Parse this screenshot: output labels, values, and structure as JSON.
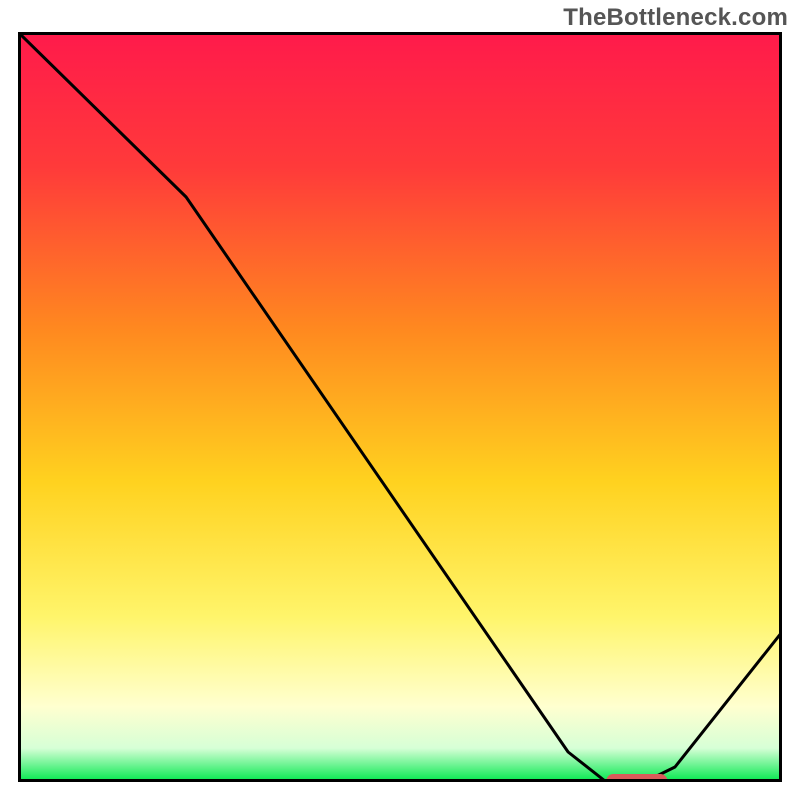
{
  "watermark": "TheBottleneck.com",
  "colors": {
    "gradient_stops": [
      {
        "offset": 0.0,
        "color": "#ff1a4b"
      },
      {
        "offset": 0.18,
        "color": "#ff3a3a"
      },
      {
        "offset": 0.4,
        "color": "#ff8a1f"
      },
      {
        "offset": 0.6,
        "color": "#ffd21f"
      },
      {
        "offset": 0.78,
        "color": "#fff56b"
      },
      {
        "offset": 0.9,
        "color": "#ffffd0"
      },
      {
        "offset": 0.955,
        "color": "#d6ffd6"
      },
      {
        "offset": 1.0,
        "color": "#00e84c"
      }
    ],
    "curve": "#000000",
    "border": "#000000",
    "marker": "#d85a5a"
  },
  "chart_data": {
    "type": "line",
    "title": "",
    "xlabel": "",
    "ylabel": "",
    "xlim": [
      0,
      100
    ],
    "ylim": [
      0,
      100
    ],
    "x": [
      0,
      22,
      72,
      77,
      82,
      86,
      100
    ],
    "values": [
      100,
      78,
      4,
      0,
      0,
      2,
      20
    ],
    "marker": {
      "x_start": 77,
      "x_end": 85,
      "y": 0
    },
    "annotations": []
  }
}
